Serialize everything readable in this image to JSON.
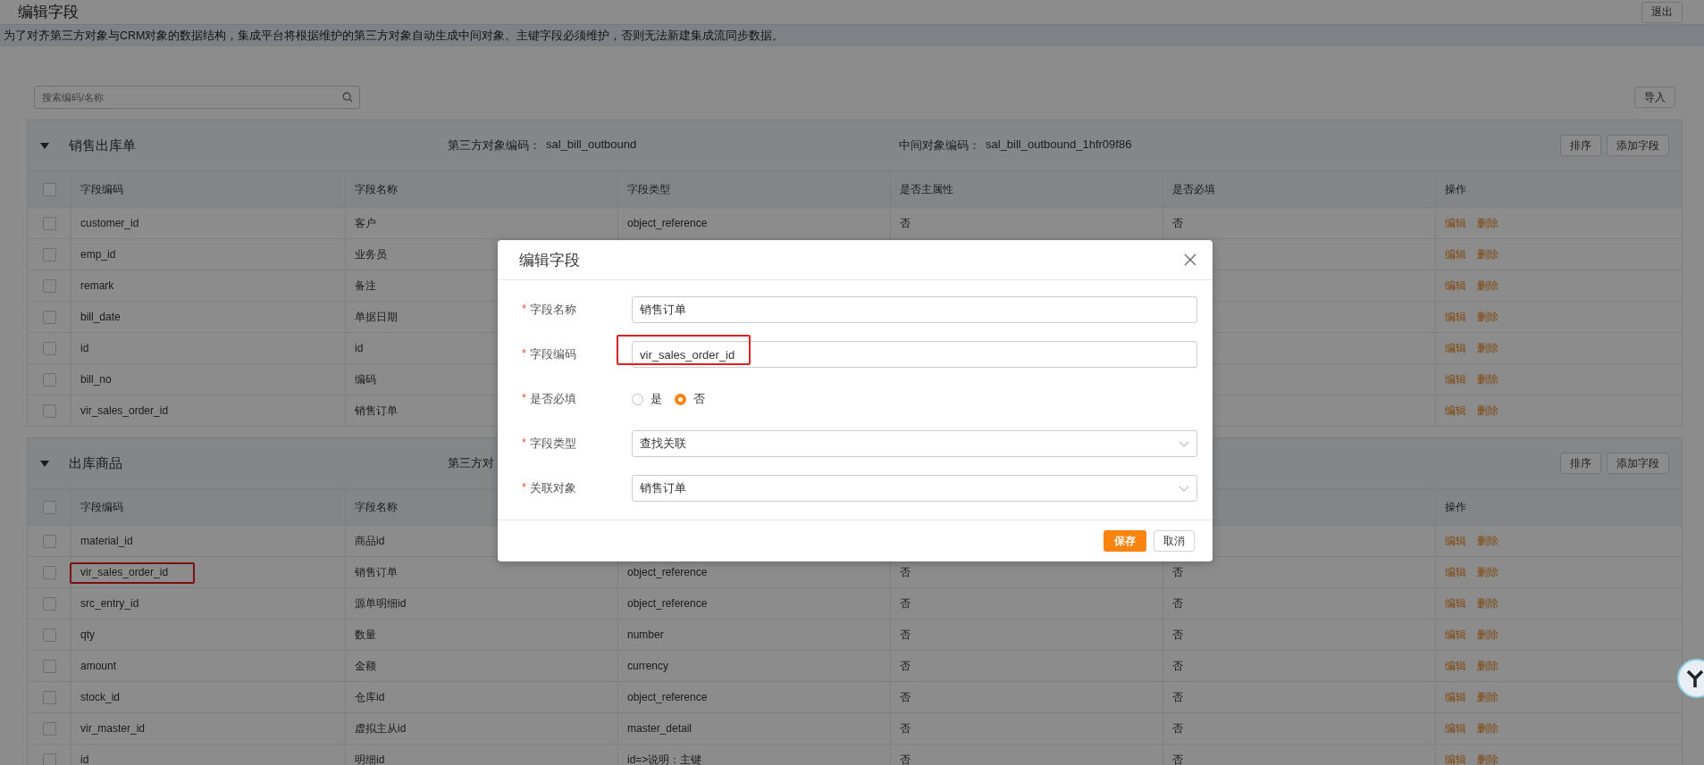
{
  "page": {
    "title": "编辑字段",
    "exit_button": "退出",
    "notice": "为了对齐第三方对象与CRM对象的数据结构，集成平台将根据维护的第三方对象自动生成中间对象。主键字段必须维护，否则无法新建集成流同步数据。",
    "search": {
      "placeholder": "搜索编码/名称"
    },
    "import_button": "导入"
  },
  "sections": [
    {
      "name": "销售出库单",
      "expanded": true,
      "third_party_label": "第三方对象编码：",
      "third_party_code": "sal_bill_outbound",
      "middle_label": "中间对象编码：",
      "middle_code": "sal_bill_outbound_1hfr09f86",
      "buttons": [
        "排序",
        "添加字段"
      ],
      "header_checked": false,
      "columns": {
        "code": "字段编码",
        "name": "字段名称",
        "type": "字段类型",
        "primary": "是否主属性",
        "required": "是否必填",
        "actions": "操作"
      },
      "rows": [
        {
          "checked": false,
          "highlighted": false,
          "cells": {
            "code": "customer_id",
            "name": "客户",
            "type": "object_reference",
            "primary": "否",
            "required": "否"
          },
          "actions": [
            "编辑",
            "删除"
          ]
        },
        {
          "checked": false,
          "highlighted": false,
          "cells": {
            "code": "emp_id",
            "name": "业务员"
          },
          "actions": [
            "编辑",
            "删除"
          ]
        },
        {
          "checked": false,
          "highlighted": false,
          "cells": {
            "code": "remark",
            "name": "备注"
          },
          "actions": [
            "编辑",
            "删除"
          ]
        },
        {
          "checked": false,
          "highlighted": false,
          "cells": {
            "code": "bill_date",
            "name": "单据日期"
          },
          "actions": [
            "编辑",
            "删除"
          ]
        },
        {
          "checked": false,
          "highlighted": false,
          "cells": {
            "code": "id",
            "name": "id"
          },
          "actions": [
            "编辑",
            "删除"
          ]
        },
        {
          "checked": false,
          "highlighted": false,
          "cells": {
            "code": "bill_no",
            "name": "编码"
          },
          "actions": [
            "编辑",
            "删除"
          ]
        },
        {
          "checked": false,
          "highlighted": false,
          "cells": {
            "code": "vir_sales_order_id",
            "name": "销售订单"
          },
          "actions": [
            "编辑",
            "删除"
          ]
        }
      ]
    },
    {
      "name": "出库商品",
      "expanded": true,
      "third_party_label": "第三方对",
      "buttons": [
        "排序",
        "添加字段"
      ],
      "header_checked": false,
      "columns": {
        "code": "字段编码",
        "name": "字段名称",
        "actions": "操作"
      },
      "rows": [
        {
          "checked": false,
          "highlighted": false,
          "cells": {
            "code": "material_id",
            "name": "商品id"
          },
          "actions": [
            "编辑",
            "删除"
          ]
        },
        {
          "checked": false,
          "highlighted": true,
          "cells": {
            "code": "vir_sales_order_id",
            "name": "销售订单",
            "type": "object_reference",
            "primary": "否",
            "required": "否"
          },
          "actions": [
            "编辑",
            "删除"
          ]
        },
        {
          "checked": false,
          "highlighted": false,
          "cells": {
            "code": "src_entry_id",
            "name": "源单明细id",
            "type": "object_reference",
            "primary": "否",
            "required": "否"
          },
          "actions": [
            "编辑",
            "删除"
          ]
        },
        {
          "checked": false,
          "highlighted": false,
          "cells": {
            "code": "qty",
            "name": "数量",
            "type": "number",
            "primary": "否",
            "required": "否"
          },
          "actions": [
            "编辑",
            "删除"
          ]
        },
        {
          "checked": false,
          "highlighted": false,
          "cells": {
            "code": "amount",
            "name": "金额",
            "type": "currency",
            "primary": "否",
            "required": "否"
          },
          "actions": [
            "编辑",
            "删除"
          ]
        },
        {
          "checked": false,
          "highlighted": false,
          "cells": {
            "code": "stock_id",
            "name": "仓库id",
            "type": "object_reference",
            "primary": "否",
            "required": "否"
          },
          "actions": [
            "编辑",
            "删除"
          ]
        },
        {
          "checked": false,
          "highlighted": false,
          "cells": {
            "code": "vir_master_id",
            "name": "虚拟主从id",
            "type": "master_detail",
            "primary": "否",
            "required": "否"
          },
          "actions": [
            "编辑",
            "删除"
          ]
        },
        {
          "checked": false,
          "highlighted": false,
          "cells": {
            "code": "id",
            "name": "明细id",
            "type": "id=>说明：主键",
            "primary": "否",
            "required": "否"
          },
          "actions": [
            "编辑",
            "删除"
          ]
        }
      ]
    }
  ],
  "dialog": {
    "title": "编辑字段",
    "fields": [
      {
        "kind": "text",
        "required_mark": "*",
        "label": "字段名称",
        "value": "销售订单",
        "highlighted": false
      },
      {
        "kind": "text",
        "required_mark": "*",
        "label": "字段编码",
        "value": "vir_sales_order_id",
        "highlighted": true
      },
      {
        "kind": "radio",
        "required_mark": "*",
        "label": "是否必填",
        "options": [
          {
            "label": "是",
            "selected": false
          },
          {
            "label": "否",
            "selected": true
          }
        ]
      },
      {
        "kind": "select",
        "required_mark": "*",
        "label": "字段类型",
        "value": "查找关联"
      },
      {
        "kind": "select",
        "required_mark": "*",
        "label": "关联对象",
        "value": "销售订单"
      }
    ],
    "save_button": "保存",
    "cancel_button": "取消"
  }
}
